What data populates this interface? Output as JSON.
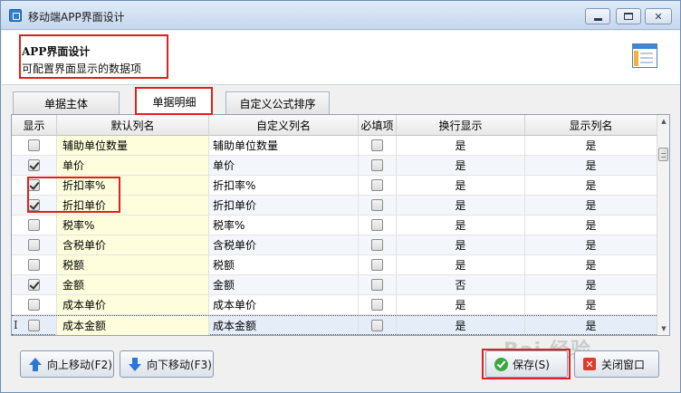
{
  "window": {
    "title": "移动端APP界面设计"
  },
  "header": {
    "title": "APP界面设计",
    "subtitle": "可配置界面显示的数据项"
  },
  "tabs": [
    {
      "label": "单据主体",
      "active": false
    },
    {
      "label": "单据明细",
      "active": true
    },
    {
      "label": "自定义公式排序",
      "active": false
    }
  ],
  "grid": {
    "columns": [
      "显示",
      "默认列名",
      "自定义列名",
      "必填项",
      "换行显示",
      "显示列名"
    ],
    "rows": [
      {
        "show": false,
        "default": "辅助单位数量",
        "custom": "辅助单位数量",
        "required": false,
        "wrap": "是",
        "showname": "是"
      },
      {
        "show": true,
        "default": "单价",
        "custom": "单价",
        "required": false,
        "wrap": "是",
        "showname": "是"
      },
      {
        "show": true,
        "default": "折扣率%",
        "custom": "折扣率%",
        "required": false,
        "wrap": "是",
        "showname": "是"
      },
      {
        "show": true,
        "default": "折扣单价",
        "custom": "折扣单价",
        "required": false,
        "wrap": "是",
        "showname": "是"
      },
      {
        "show": false,
        "default": "税率%",
        "custom": "税率%",
        "required": false,
        "wrap": "是",
        "showname": "是"
      },
      {
        "show": false,
        "default": "含税单价",
        "custom": "含税单价",
        "required": false,
        "wrap": "是",
        "showname": "是"
      },
      {
        "show": false,
        "default": "税额",
        "custom": "税额",
        "required": false,
        "wrap": "是",
        "showname": "是"
      },
      {
        "show": true,
        "default": "金额",
        "custom": "金额",
        "required": false,
        "wrap": "否",
        "showname": "是"
      },
      {
        "show": false,
        "default": "成本单价",
        "custom": "成本单价",
        "required": false,
        "wrap": "是",
        "showname": "是"
      },
      {
        "show": false,
        "default": "成本金额",
        "custom": "成本金额",
        "required": false,
        "wrap": "是",
        "showname": "是"
      }
    ],
    "row_indicator": "I"
  },
  "buttons": {
    "move_up": "向上移动(F2)",
    "move_down": "向下移动(F3)",
    "save": "保存(S)",
    "close": "关闭窗口"
  },
  "icons": {
    "app": "app-window-icon",
    "header": "form-layout-icon",
    "move_up": "arrow-up-icon",
    "move_down": "arrow-down-icon",
    "save": "check-circle-icon",
    "close": "close-x-icon"
  },
  "watermark": "Bai 经验",
  "colors": {
    "highlight_red": "#e02020",
    "accent_blue": "#2b78d4",
    "default_col_bg": "#fefedc"
  }
}
